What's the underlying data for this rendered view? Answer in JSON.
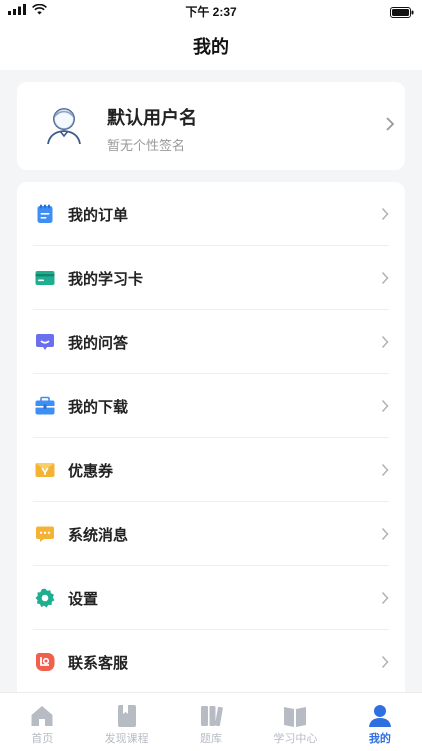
{
  "status": {
    "time": "下午 2:37"
  },
  "nav": {
    "title": "我的"
  },
  "profile": {
    "username": "默认用户名",
    "signature": "暂无个性签名"
  },
  "menu": {
    "items": [
      {
        "label": "我的订单",
        "icon": "order-icon"
      },
      {
        "label": "我的学习卡",
        "icon": "study-card-icon"
      },
      {
        "label": "我的问答",
        "icon": "qa-icon"
      },
      {
        "label": "我的下载",
        "icon": "download-icon"
      },
      {
        "label": "优惠券",
        "icon": "coupon-icon"
      },
      {
        "label": "系统消息",
        "icon": "message-icon"
      },
      {
        "label": "设置",
        "icon": "settings-icon"
      },
      {
        "label": "联系客服",
        "icon": "customer-service-icon"
      }
    ]
  },
  "tabs": [
    {
      "label": "首页",
      "icon": "home-icon"
    },
    {
      "label": "发现课程",
      "icon": "discover-courses-icon"
    },
    {
      "label": "题库",
      "icon": "question-bank-icon"
    },
    {
      "label": "学习中心",
      "icon": "study-center-icon"
    },
    {
      "label": "我的",
      "icon": "profile-icon",
      "active": true
    }
  ],
  "colors": {
    "accent": "#2f6fe0",
    "inactive": "#b7bcc4",
    "background": "#f4f5f7"
  }
}
